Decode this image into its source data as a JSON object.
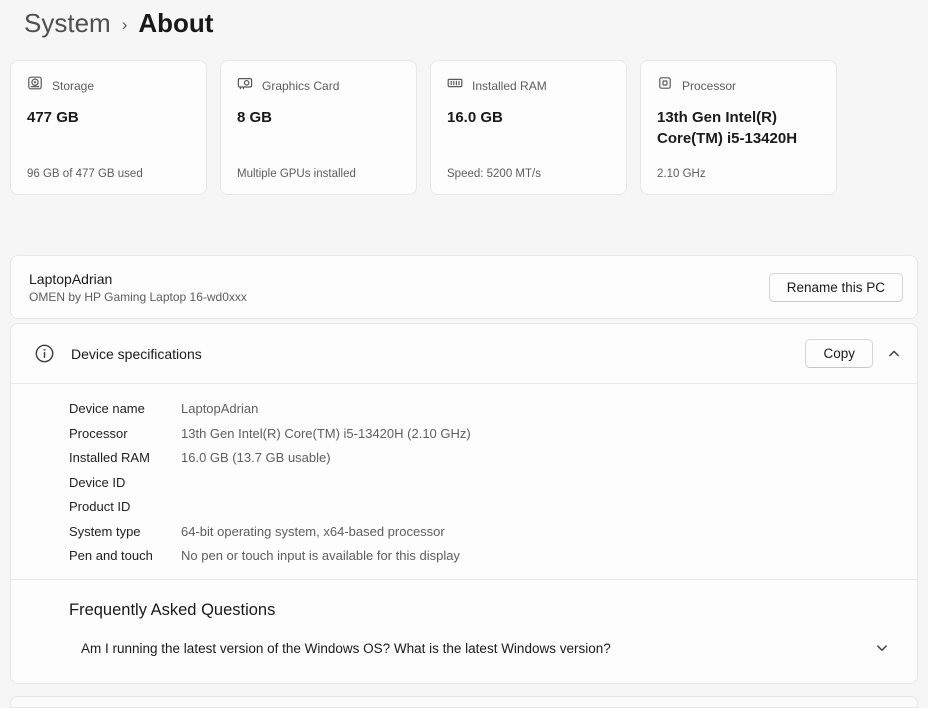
{
  "breadcrumb": {
    "parent": "System",
    "separator": "›",
    "current": "About"
  },
  "cards": [
    {
      "icon": "storage-icon",
      "label": "Storage",
      "value": "477 GB",
      "caption": "96 GB of 477 GB used"
    },
    {
      "icon": "gpu-icon",
      "label": "Graphics Card",
      "value": "8 GB",
      "caption": "Multiple GPUs installed"
    },
    {
      "icon": "ram-icon",
      "label": "Installed RAM",
      "value": "16.0 GB",
      "caption": "Speed: 5200 MT/s"
    },
    {
      "icon": "cpu-icon",
      "label": "Processor",
      "value": "13th Gen Intel(R) Core(TM) i5-13420H",
      "caption": "2.10 GHz"
    }
  ],
  "device": {
    "name": "LaptopAdrian",
    "model": "OMEN by HP Gaming Laptop 16-wd0xxx",
    "rename_button": "Rename this PC"
  },
  "specs": {
    "title": "Device specifications",
    "copy_button": "Copy",
    "rows": [
      {
        "label": "Device name",
        "value": "LaptopAdrian"
      },
      {
        "label": "Processor",
        "value": "13th Gen Intel(R) Core(TM) i5-13420H (2.10 GHz)"
      },
      {
        "label": "Installed RAM",
        "value": "16.0 GB (13.7 GB usable)"
      },
      {
        "label": "Device ID",
        "value": ""
      },
      {
        "label": "Product ID",
        "value": ""
      },
      {
        "label": "System type",
        "value": "64-bit operating system, x64-based processor"
      },
      {
        "label": "Pen and touch",
        "value": "No pen or touch input is available for this display"
      }
    ]
  },
  "faq": {
    "title": "Frequently Asked Questions",
    "questions": [
      {
        "text": "Am I running the latest version of the Windows OS? What is the latest Windows version?"
      }
    ]
  },
  "colors": {
    "page_background": "#f6f6f6",
    "card_background": "#fdfdfd",
    "card_border": "#e7e7e7",
    "text_primary": "#1a1a1a",
    "text_secondary": "#5d5d5d"
  }
}
